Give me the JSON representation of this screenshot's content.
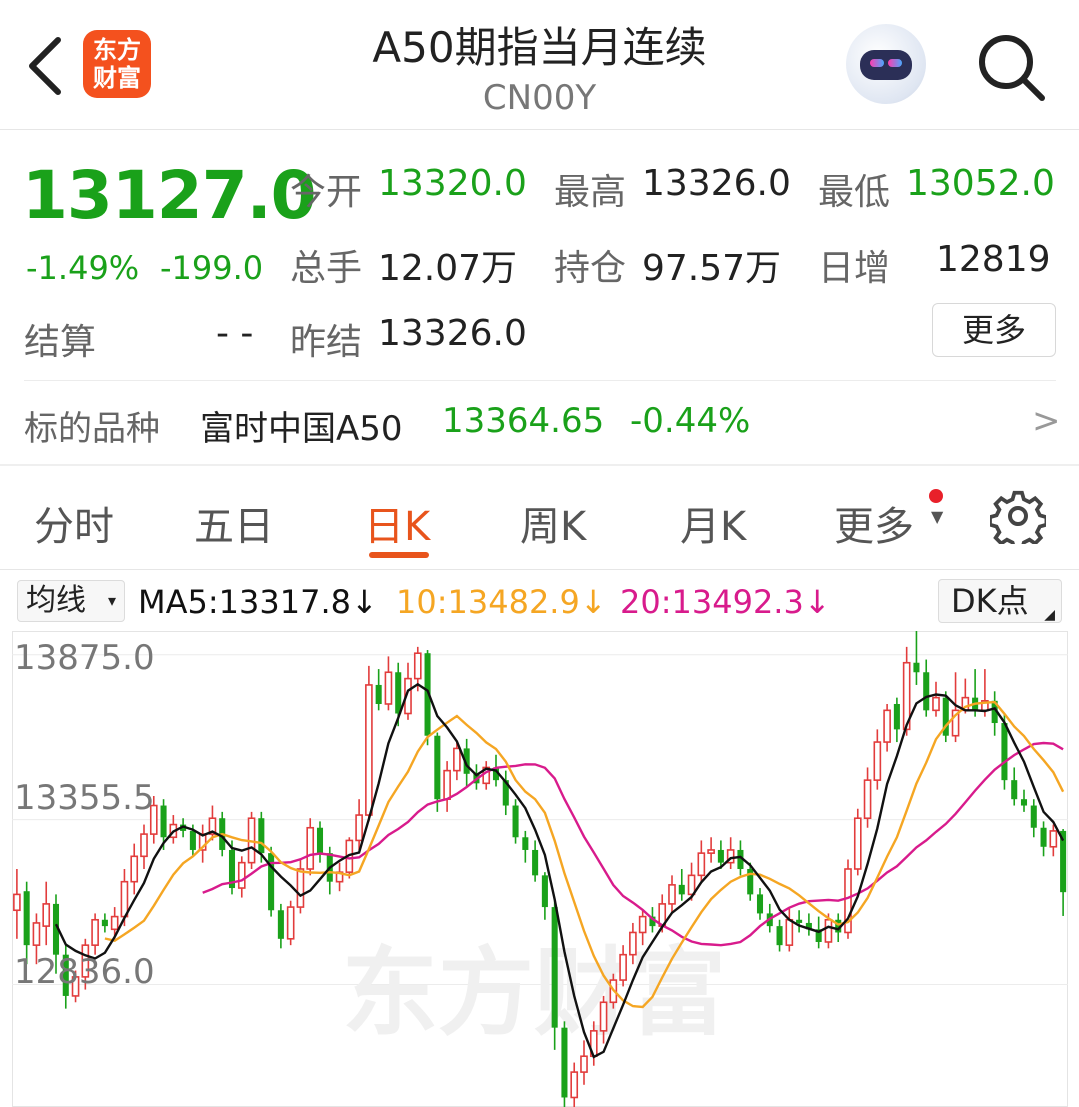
{
  "header": {
    "back_icon": "chevron-left-icon",
    "logo_text": "东方\n财富",
    "logo_line1": "东方",
    "logo_line2": "财富",
    "title": "A50期指当月连续",
    "code": "CN00Y",
    "assistant_icon": "robot-avatar-icon",
    "search_icon": "search-icon"
  },
  "quote": {
    "last_price": "13127.0",
    "change_pct": "-1.49%",
    "change": "-199.0",
    "open_label": "今开",
    "open": "13320.0",
    "high_label": "最高",
    "high": "13326.0",
    "low_label": "最低",
    "low": "13052.0",
    "volume_label": "总手",
    "volume": "12.07万",
    "oi_label": "持仓",
    "oi": "97.57万",
    "oi_change_label": "日增",
    "oi_change": "12819",
    "settle_label": "结算",
    "settle": "- -",
    "prev_settle_label": "昨结",
    "prev_settle": "13326.0",
    "more_label": "更多",
    "color_down": "#1aa11a"
  },
  "underlying": {
    "label": "标的品种",
    "name": "富时中国A50",
    "price": "13364.65",
    "change_pct": "-0.44%",
    "arrow": ">"
  },
  "tabs": [
    {
      "label": "分时",
      "active": false
    },
    {
      "label": "五日",
      "active": false
    },
    {
      "label": "日K",
      "active": true
    },
    {
      "label": "周K",
      "active": false
    },
    {
      "label": "月K",
      "active": false
    },
    {
      "label": "更多",
      "active": false
    }
  ],
  "settings_icon": "gear-icon",
  "ma_bar": {
    "select_label": "均线",
    "ma5": "MA5:13317.8↓",
    "ma10": "10:13482.9↓",
    "ma20": "20:13492.3↓",
    "ma5_color": "#111111",
    "ma10_color": "#f5a623",
    "ma20_color": "#d81b8c",
    "dk_label": "DK点"
  },
  "chart_data": {
    "type": "candlestick",
    "y_ticks": [
      "13875.0",
      "13355.5",
      "12836.0"
    ],
    "ylim": [
      12450,
      13950
    ],
    "up_color": "#e23c3c",
    "down_color": "#1aa11a",
    "watermark": "东方财富",
    "candles": [
      [
        13070,
        13120,
        12980,
        13200
      ],
      [
        13130,
        12960,
        12900,
        13160
      ],
      [
        12960,
        13030,
        12900,
        13060
      ],
      [
        13020,
        13090,
        12960,
        13160
      ],
      [
        13090,
        12930,
        12870,
        13120
      ],
      [
        12930,
        12800,
        12760,
        12960
      ],
      [
        12800,
        12860,
        12780,
        12880
      ],
      [
        12860,
        12960,
        12820,
        12980
      ],
      [
        12960,
        13040,
        12930,
        13060
      ],
      [
        13040,
        13020,
        13000,
        13060
      ],
      [
        13010,
        13050,
        12980,
        13080
      ],
      [
        13050,
        13160,
        13020,
        13200
      ],
      [
        13160,
        13240,
        13120,
        13280
      ],
      [
        13240,
        13310,
        13200,
        13340
      ],
      [
        13310,
        13400,
        13280,
        13430
      ],
      [
        13400,
        13300,
        13260,
        13420
      ],
      [
        13300,
        13340,
        13280,
        13370
      ],
      [
        13340,
        13320,
        13300,
        13360
      ],
      [
        13320,
        13260,
        13240,
        13340
      ],
      [
        13260,
        13310,
        13220,
        13340
      ],
      [
        13310,
        13360,
        13290,
        13400
      ],
      [
        13360,
        13260,
        13240,
        13380
      ],
      [
        13260,
        13140,
        13120,
        13290
      ],
      [
        13140,
        13220,
        13110,
        13240
      ],
      [
        13220,
        13360,
        13200,
        13380
      ],
      [
        13360,
        13250,
        13220,
        13380
      ],
      [
        13250,
        13070,
        13050,
        13270
      ],
      [
        13070,
        12980,
        12950,
        13090
      ],
      [
        12980,
        13080,
        12960,
        13100
      ],
      [
        13080,
        13200,
        13060,
        13230
      ],
      [
        13200,
        13330,
        13180,
        13360
      ],
      [
        13330,
        13250,
        13220,
        13350
      ],
      [
        13250,
        13160,
        13120,
        13270
      ],
      [
        13160,
        13190,
        13130,
        13220
      ],
      [
        13190,
        13290,
        13170,
        13300
      ],
      [
        13290,
        13370,
        13260,
        13420
      ],
      [
        13370,
        13780,
        13350,
        13840
      ],
      [
        13780,
        13720,
        13700,
        13830
      ],
      [
        13720,
        13820,
        13700,
        13870
      ],
      [
        13820,
        13690,
        13650,
        13850
      ],
      [
        13690,
        13800,
        13670,
        13850
      ],
      [
        13800,
        13880,
        13760,
        13900
      ],
      [
        13880,
        13620,
        13590,
        13890
      ],
      [
        13620,
        13420,
        13380,
        13630
      ],
      [
        13420,
        13510,
        13380,
        13540
      ],
      [
        13510,
        13580,
        13480,
        13600
      ],
      [
        13580,
        13500,
        13460,
        13610
      ],
      [
        13500,
        13470,
        13450,
        13530
      ],
      [
        13470,
        13520,
        13450,
        13540
      ],
      [
        13520,
        13480,
        13460,
        13560
      ],
      [
        13480,
        13400,
        13370,
        13510
      ],
      [
        13400,
        13300,
        13280,
        13420
      ],
      [
        13300,
        13260,
        13220,
        13320
      ],
      [
        13260,
        13180,
        13160,
        13290
      ],
      [
        13180,
        13080,
        13040,
        13190
      ],
      [
        13080,
        12700,
        12630,
        13100
      ],
      [
        12700,
        12480,
        12430,
        12720
      ],
      [
        12480,
        12560,
        12450,
        12590
      ],
      [
        12560,
        12610,
        12520,
        12660
      ],
      [
        12610,
        12690,
        12580,
        12720
      ],
      [
        12690,
        12780,
        12650,
        12800
      ],
      [
        12780,
        12850,
        12760,
        12870
      ],
      [
        12850,
        12930,
        12830,
        12960
      ],
      [
        12930,
        13000,
        12900,
        13030
      ],
      [
        13000,
        13050,
        12960,
        13070
      ],
      [
        13050,
        13020,
        13000,
        13080
      ],
      [
        13020,
        13090,
        13000,
        13120
      ],
      [
        13090,
        13150,
        13060,
        13180
      ],
      [
        13150,
        13120,
        13100,
        13200
      ],
      [
        13120,
        13180,
        13100,
        13220
      ],
      [
        13180,
        13250,
        13160,
        13290
      ],
      [
        13250,
        13260,
        13220,
        13300
      ],
      [
        13260,
        13220,
        13200,
        13290
      ],
      [
        13220,
        13260,
        13200,
        13300
      ],
      [
        13260,
        13200,
        13180,
        13290
      ],
      [
        13200,
        13120,
        13100,
        13220
      ],
      [
        13120,
        13060,
        13040,
        13140
      ],
      [
        13060,
        13020,
        13000,
        13090
      ],
      [
        13020,
        12960,
        12940,
        13040
      ],
      [
        12960,
        13040,
        12940,
        13080
      ],
      [
        13040,
        13030,
        13000,
        13070
      ],
      [
        13030,
        13010,
        12990,
        13060
      ],
      [
        13010,
        12970,
        12950,
        13050
      ],
      [
        12970,
        13040,
        12950,
        13060
      ],
      [
        13040,
        13000,
        12970,
        13060
      ],
      [
        13000,
        13200,
        12980,
        13230
      ],
      [
        13200,
        13360,
        13180,
        13390
      ],
      [
        13360,
        13480,
        13330,
        13520
      ],
      [
        13480,
        13600,
        13450,
        13640
      ],
      [
        13600,
        13700,
        13570,
        13720
      ],
      [
        13720,
        13640,
        13600,
        13740
      ],
      [
        13640,
        13850,
        13620,
        13900
      ],
      [
        13850,
        13820,
        13780,
        13950
      ],
      [
        13820,
        13700,
        13680,
        13860
      ],
      [
        13700,
        13740,
        13680,
        13790
      ],
      [
        13740,
        13620,
        13600,
        13760
      ],
      [
        13620,
        13700,
        13600,
        13820
      ],
      [
        13700,
        13740,
        13690,
        13800
      ],
      [
        13740,
        13700,
        13680,
        13830
      ],
      [
        13700,
        13730,
        13680,
        13830
      ],
      [
        13730,
        13660,
        13620,
        13760
      ],
      [
        13660,
        13480,
        13450,
        13690
      ],
      [
        13480,
        13420,
        13400,
        13520
      ],
      [
        13420,
        13400,
        13380,
        13450
      ],
      [
        13400,
        13330,
        13300,
        13420
      ],
      [
        13330,
        13270,
        13240,
        13350
      ],
      [
        13270,
        13320,
        13240,
        13340
      ],
      [
        13320,
        13127,
        13052,
        13326
      ]
    ]
  }
}
